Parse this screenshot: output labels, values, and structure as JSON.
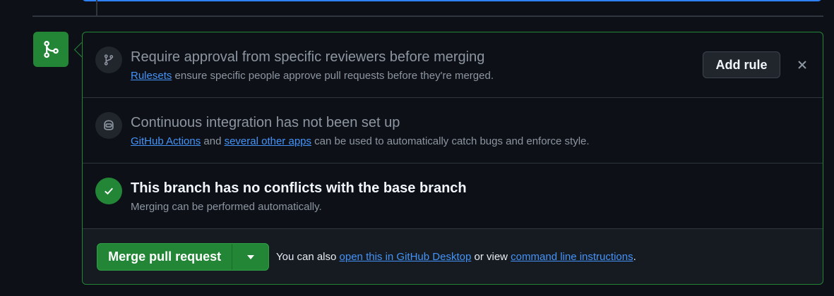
{
  "colors": {
    "background": "#0d1117",
    "success_green": "#238636",
    "link_blue": "#4493f8",
    "muted_text": "#8d96a0",
    "border": "#30363d"
  },
  "header_icon": "git-merge-icon",
  "reviewers": {
    "icon": "git-branch-icon",
    "title": "Require approval from specific reviewers before merging",
    "link_text": "Rulesets",
    "text": " ensure specific people approve pull requests before they're merged.",
    "add_rule_label": "Add rule",
    "close_icon": "close-icon"
  },
  "ci": {
    "icon": "robot-icon",
    "title": "Continuous integration has not been set up",
    "link1": "GitHub Actions",
    "and_text": " and ",
    "link2": "several other apps",
    "text": " can be used to automatically catch bugs and enforce style."
  },
  "conflicts": {
    "icon": "check-icon",
    "title": "This branch has no conflicts with the base branch",
    "subtitle": "Merging can be performed automatically."
  },
  "merge": {
    "button_label": "Merge pull request",
    "dropdown_icon": "triangle-down-icon",
    "prefix": "You can also ",
    "desktop_link": "open this in GitHub Desktop",
    "middle": " or view ",
    "cli_link": "command line instructions",
    "suffix": "."
  }
}
